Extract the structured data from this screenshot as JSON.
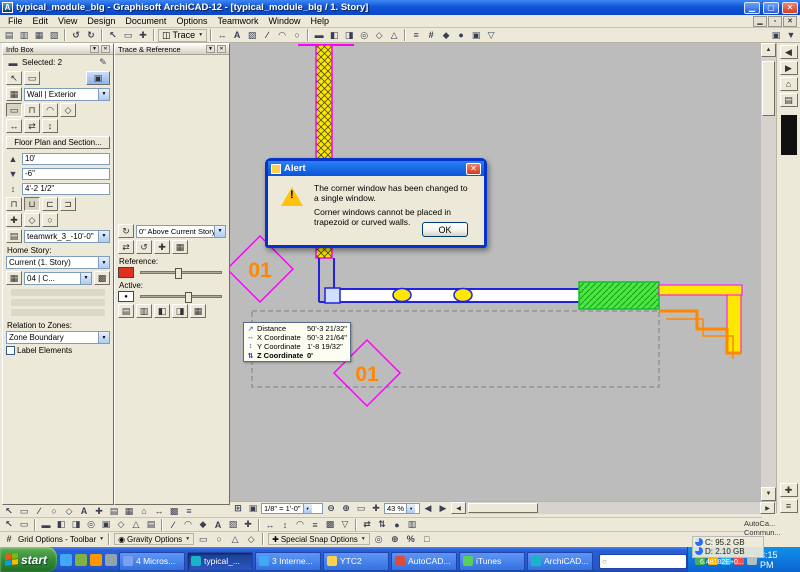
{
  "window": {
    "title": "typical_module_blg - Graphisoft ArchiCAD-12 - [typical_module_blg / 1. Story]",
    "menus": [
      "File",
      "Edit",
      "View",
      "Design",
      "Document",
      "Options",
      "Teamwork",
      "Window",
      "Help"
    ]
  },
  "toolbar": {
    "trace_label": "Trace"
  },
  "infobox": {
    "title": "Info Box",
    "selected": "Selected: 2",
    "favorite": "Wall | Exterior",
    "section_button": "Floor Plan and Section...",
    "field_top": "10'",
    "field_base": "-6\"",
    "field_height": "4'-2 1/2\"",
    "layer": "teamwrk_3_-10'-0\"",
    "home_story_label": "Home Story:",
    "home_story": "Current (1. Story)",
    "pen_set": "04 | C...",
    "relation_label": "Relation to Zones:",
    "relation": "Zone Boundary",
    "label_elements": "Label Elements"
  },
  "trace_palette": {
    "title": "Trace & Reference",
    "story": "0\" Above Current Story",
    "reference_label": "Reference:",
    "active_label": "Active:"
  },
  "alert": {
    "title": "Alert",
    "line1": "The corner window has been changed to a single window.",
    "line2": "Corner windows cannot be placed in trapezoid or curved walls.",
    "ok_label": "OK"
  },
  "tracker": {
    "rows": [
      {
        "label": "Distance",
        "value": "50'-3 21/32\""
      },
      {
        "label": "X Coordinate",
        "value": "50'-3 21/64\""
      },
      {
        "label": "Y Coordinate",
        "value": "1'-8 19/32\""
      },
      {
        "label": "Z Coordinate",
        "value": "0'"
      }
    ]
  },
  "canvas": {
    "marker1": "01",
    "marker2": "01"
  },
  "statusbar": {
    "scale": "1/8\" = 1'-0\"",
    "zoom": "43 %"
  },
  "lower_toolbars": {
    "grid_options": "Grid Options - Toolbar",
    "gravity_options": "Gravity Options",
    "snap_options": "Special Snap Options"
  },
  "gadgets": {
    "app_line1": "AutoCa...",
    "app_line2": "Commun...",
    "disk_c": "C: 95.2 GB",
    "disk_d": "D: 2.10 GB",
    "reading": "6.48182E+0..."
  },
  "taskbar": {
    "start_label": "start",
    "items": [
      "4 Micros...",
      "typical_...",
      "3 Interne...",
      "YTC2",
      "AutoCAD...",
      "iTunes",
      "ArchiCAD..."
    ],
    "time": "3:15 PM"
  }
}
